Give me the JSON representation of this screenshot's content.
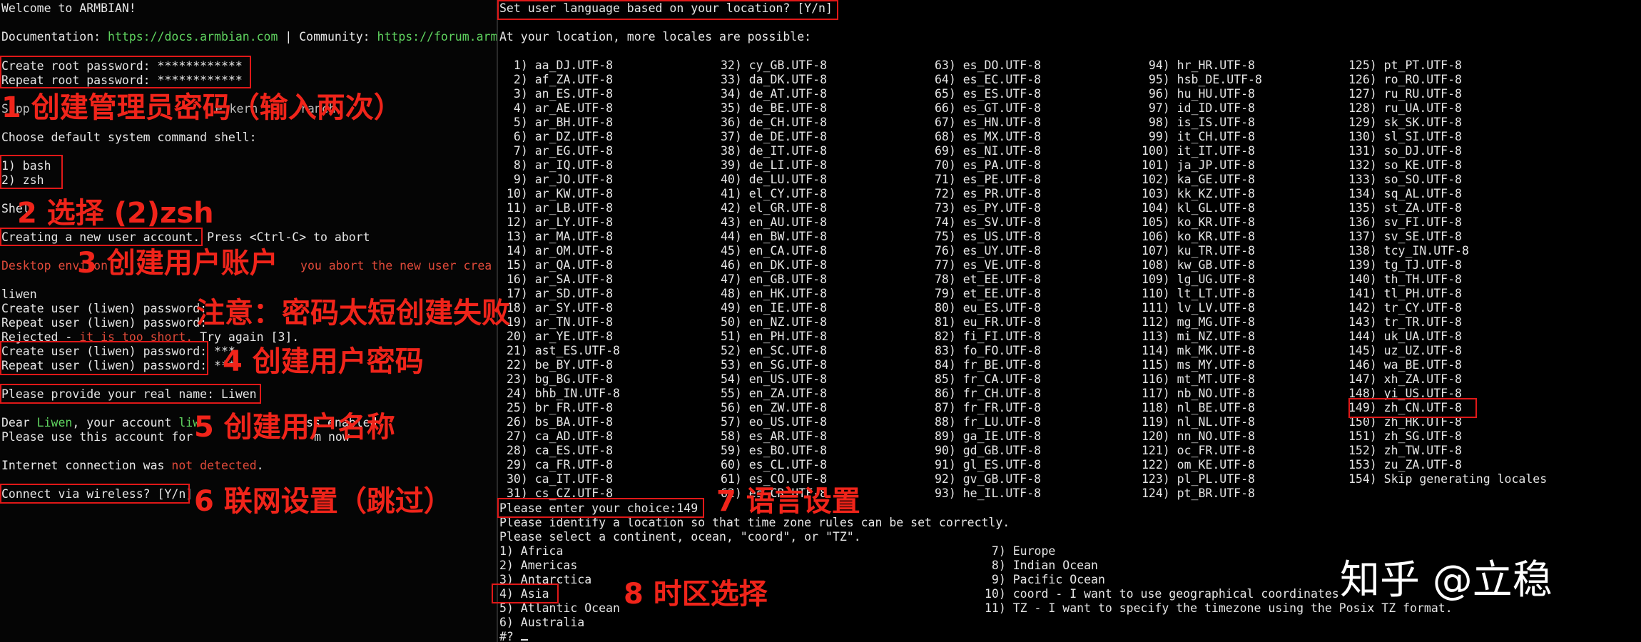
{
  "left": {
    "welcome": "Welcome to ARMBIAN!",
    "doc_label": "Documentation: ",
    "doc_url": "https://docs.armbian.com",
    "sep": " | Community: ",
    "community_url": "https://forum.armb",
    "create_root": "Create root password: ************",
    "repeat_root": "Repeat root password: ************",
    "support_prefix": "Supp",
    "support_tail": "e kern      ranch",
    "choose_shell": "Choose default system command shell:",
    "shell_1": "1) bash",
    "shell_2": "2) zsh",
    "shell_prompt": "Shel",
    "creating_user": "Creating a new user account.",
    "creating_user_tail": " Press <Ctrl-C> to abort",
    "desktop_env": "Desktop environ",
    "desktop_tail": "you abort the new user crea",
    "username": "liwen",
    "create_user_pw1": "Create user (liwen) password:",
    "repeat_user_pw1": "Repeat user (liwen) password:",
    "rejected_a": "Rejected - ",
    "rejected_b": "it is too short.",
    "rejected_c": " Try again [3].",
    "create_user_pw2": "Create user (liwen) password: ***",
    "repeat_user_pw2": "Repeat user (liwen) password: ***",
    "real_name": "Please provide your real name: Liwen",
    "dear_a": "Dear ",
    "dear_name": "Liwen",
    "dear_b": ", your account ",
    "dear_name2": "liw",
    "dear_c": "               ss enabled.",
    "use_account": "Please use this account for",
    "use_account_tail": "  m now",
    "internet_a": "Internet connection was ",
    "internet_b": "not detected",
    "internet_c": ".",
    "wireless": "Connect via wireless? [Y/n]"
  },
  "right": {
    "lang_question": "Set user language based on your location? [Y/n]",
    "locales_intro": "At your location, more locales are possible:",
    "locale_columns": [
      [
        " 1) aa_DJ.UTF-8",
        " 2) af_ZA.UTF-8",
        " 3) an_ES.UTF-8",
        " 4) ar_AE.UTF-8",
        " 5) ar_BH.UTF-8",
        " 6) ar_DZ.UTF-8",
        " 7) ar_EG.UTF-8",
        " 8) ar_IQ.UTF-8",
        " 9) ar_JO.UTF-8",
        "10) ar_KW.UTF-8",
        "11) ar_LB.UTF-8",
        "12) ar_LY.UTF-8",
        "13) ar_MA.UTF-8",
        "14) ar_OM.UTF-8",
        "15) ar_QA.UTF-8",
        "16) ar_SA.UTF-8",
        "17) ar_SD.UTF-8",
        "18) ar_SY.UTF-8",
        "19) ar_TN.UTF-8",
        "20) ar_YE.UTF-8",
        "21) ast_ES.UTF-8",
        "22) be_BY.UTF-8",
        "23) bg_BG.UTF-8",
        "24) bhb_IN.UTF-8",
        "25) br_FR.UTF-8",
        "26) bs_BA.UTF-8",
        "27) ca_AD.UTF-8",
        "28) ca_ES.UTF-8",
        "29) ca_FR.UTF-8",
        "30) ca_IT.UTF-8",
        "31) cs_CZ.UTF-8"
      ],
      [
        "32) cy_GB.UTF-8",
        "33) da_DK.UTF-8",
        "34) de_AT.UTF-8",
        "35) de_BE.UTF-8",
        "36) de_CH.UTF-8",
        "37) de_DE.UTF-8",
        "38) de_IT.UTF-8",
        "39) de_LI.UTF-8",
        "40) de_LU.UTF-8",
        "41) el_CY.UTF-8",
        "42) el_GR.UTF-8",
        "43) en_AU.UTF-8",
        "44) en_BW.UTF-8",
        "45) en_CA.UTF-8",
        "46) en_DK.UTF-8",
        "47) en_GB.UTF-8",
        "48) en_HK.UTF-8",
        "49) en_IE.UTF-8",
        "50) en_NZ.UTF-8",
        "51) en_PH.UTF-8",
        "52) en_SC.UTF-8",
        "53) en_SG.UTF-8",
        "54) en_US.UTF-8",
        "55) en_ZA.UTF-8",
        "56) en_ZW.UTF-8",
        "57) eo_US.UTF-8",
        "58) es_AR.UTF-8",
        "59) es_BO.UTF-8",
        "60) es_CL.UTF-8",
        "61) es_CO.UTF-8",
        "62) es_CR.UTF-8"
      ],
      [
        "63) es_DO.UTF-8",
        "64) es_EC.UTF-8",
        "65) es_ES.UTF-8",
        "66) es_GT.UTF-8",
        "67) es_HN.UTF-8",
        "68) es_MX.UTF-8",
        "69) es_NI.UTF-8",
        "70) es_PA.UTF-8",
        "71) es_PE.UTF-8",
        "72) es_PR.UTF-8",
        "73) es_PY.UTF-8",
        "74) es_SV.UTF-8",
        "75) es_US.UTF-8",
        "76) es_UY.UTF-8",
        "77) es_VE.UTF-8",
        "78) et_EE.UTF-8",
        "79) et_EE.UTF-8",
        "80) eu_ES.UTF-8",
        "81) eu_FR.UTF-8",
        "82) fi_FI.UTF-8",
        "83) fo_FO.UTF-8",
        "84) fr_BE.UTF-8",
        "85) fr_CA.UTF-8",
        "86) fr_CH.UTF-8",
        "87) fr_FR.UTF-8",
        "88) fr_LU.UTF-8",
        "89) ga_IE.UTF-8",
        "90) gd_GB.UTF-8",
        "91) gl_ES.UTF-8",
        "92) gv_GB.UTF-8",
        "93) he_IL.UTF-8"
      ],
      [
        " 94) hr_HR.UTF-8",
        " 95) hsb_DE.UTF-8",
        " 96) hu_HU.UTF-8",
        " 97) id_ID.UTF-8",
        " 98) is_IS.UTF-8",
        " 99) it_CH.UTF-8",
        "100) it_IT.UTF-8",
        "101) ja_JP.UTF-8",
        "102) ka_GE.UTF-8",
        "103) kk_KZ.UTF-8",
        "104) kl_GL.UTF-8",
        "105) ko_KR.UTF-8",
        "106) ko_KR.UTF-8",
        "107) ku_TR.UTF-8",
        "108) kw_GB.UTF-8",
        "109) lg_UG.UTF-8",
        "110) lt_LT.UTF-8",
        "111) lv_LV.UTF-8",
        "112) mg_MG.UTF-8",
        "113) mi_NZ.UTF-8",
        "114) mk_MK.UTF-8",
        "115) ms_MY.UTF-8",
        "116) mt_MT.UTF-8",
        "117) nb_NO.UTF-8",
        "118) nl_BE.UTF-8",
        "119) nl_NL.UTF-8",
        "120) nn_NO.UTF-8",
        "121) oc_FR.UTF-8",
        "122) om_KE.UTF-8",
        "123) pl_PL.UTF-8",
        "124) pt_BR.UTF-8"
      ],
      [
        "125) pt_PT.UTF-8",
        "126) ro_RO.UTF-8",
        "127) ru_RU.UTF-8",
        "128) ru_UA.UTF-8",
        "129) sk_SK.UTF-8",
        "130) sl_SI.UTF-8",
        "131) so_DJ.UTF-8",
        "132) so_KE.UTF-8",
        "133) so_SO.UTF-8",
        "134) sq_AL.UTF-8",
        "135) st_ZA.UTF-8",
        "136) sv_FI.UTF-8",
        "137) sv_SE.UTF-8",
        "138) tcy_IN.UTF-8",
        "139) tg_TJ.UTF-8",
        "140) th_TH.UTF-8",
        "141) tl_PH.UTF-8",
        "142) tr_CY.UTF-8",
        "143) tr_TR.UTF-8",
        "144) uk_UA.UTF-8",
        "145) uz_UZ.UTF-8",
        "146) wa_BE.UTF-8",
        "147) xh_ZA.UTF-8",
        "148) yi_US.UTF-8",
        "149) zh_CN.UTF-8",
        "150) zh_HK.UTF-8",
        "151) zh_SG.UTF-8",
        "152) zh_TW.UTF-8",
        "153) zu_ZA.UTF-8",
        "154) Skip generating locales"
      ]
    ],
    "choice_prompt": "Please enter your choice:149",
    "tz_identify": "Please identify a location so that time zone rules can be set correctly.",
    "tz_select": "Please select a continent, ocean, \"coord\", or \"TZ\".",
    "tz_left": [
      "1) Africa",
      "2) Americas",
      "3) Antarctica",
      "4) Asia",
      "5) Atlantic Ocean",
      "6) Australia"
    ],
    "tz_right": [
      " 7) Europe",
      " 8) Indian Ocean",
      " 9) Pacific Ocean",
      "10) coord - I want to use geographical coordinates",
      "11) TZ - I want to specify the timezone using the Posix TZ format."
    ],
    "tz_prompt": "#? "
  },
  "notes": {
    "n1": "1 创建管理员密码（输入两次）",
    "n2": "2 选择 (2)zsh",
    "n3": "3 创建用户账户",
    "warn": "注意：密码太短创建失败",
    "n4": "4 创建用户密码",
    "n5": "5 创建用户名称",
    "n6": "6 联网设置（跳过）",
    "n7": "7 语言设置",
    "n8": "8 时区选择"
  },
  "watermark": "知乎 @立稳",
  "colors": {
    "annotation": "#f0241a",
    "link": "#5fd35f",
    "error": "#e04a3a",
    "text": "#e6e6e6"
  }
}
